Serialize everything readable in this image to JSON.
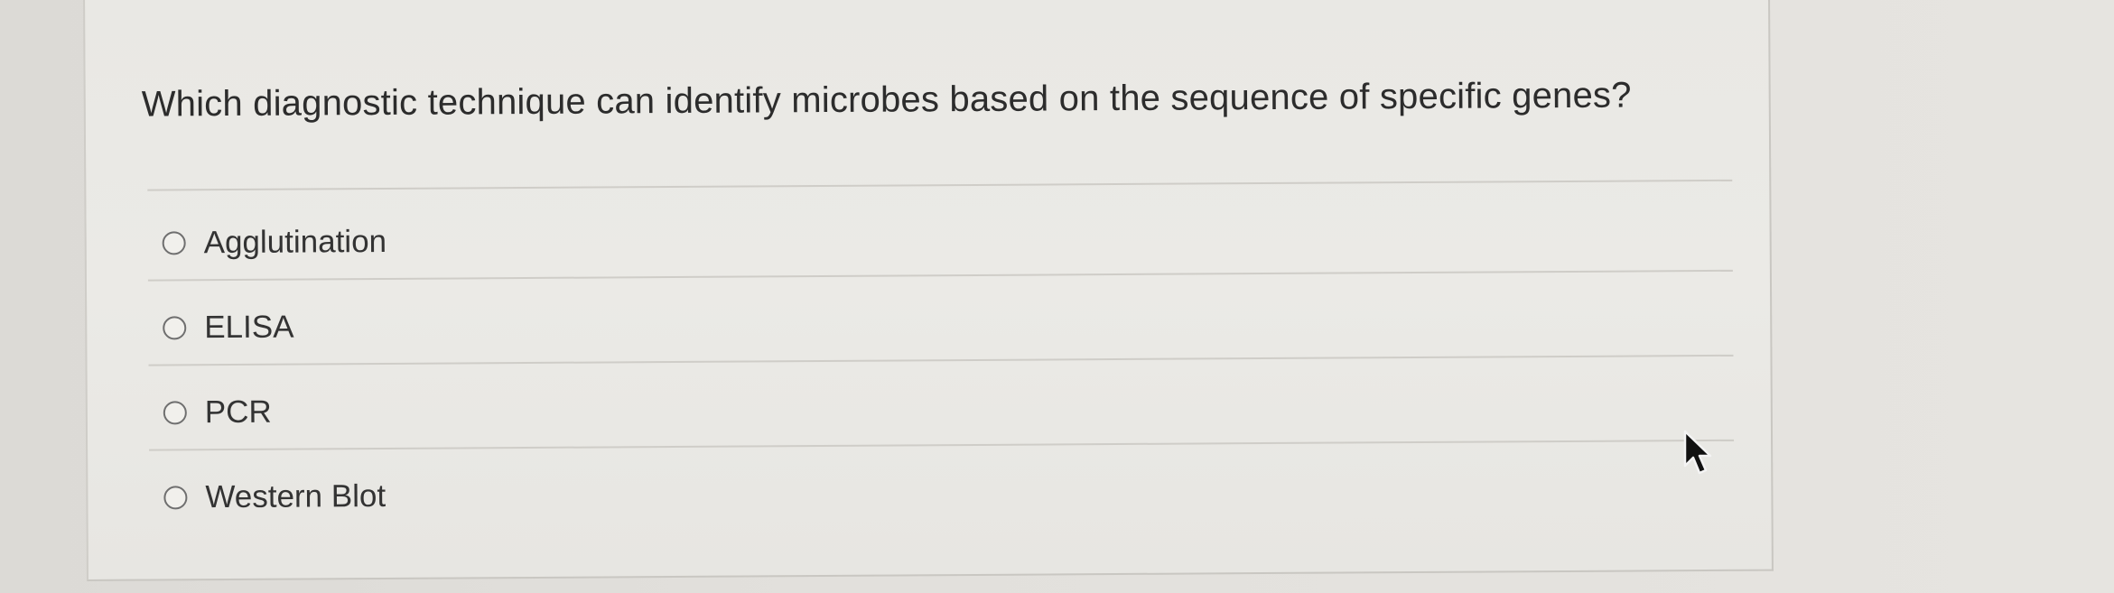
{
  "quiz": {
    "question": "Which diagnostic technique can identify microbes based on the sequence of specific genes?",
    "answers": [
      {
        "label": "Agglutination",
        "selected": false
      },
      {
        "label": "ELISA",
        "selected": false
      },
      {
        "label": "PCR",
        "selected": false
      },
      {
        "label": "Western Blot",
        "selected": false
      }
    ]
  },
  "icons": {
    "radio": "radio-button-empty-icon",
    "cursor": "mouse-pointer-icon"
  },
  "colors": {
    "text": "#2c2c2c",
    "radio_border": "#6f6f6f",
    "divider": "#cfcdc8"
  }
}
